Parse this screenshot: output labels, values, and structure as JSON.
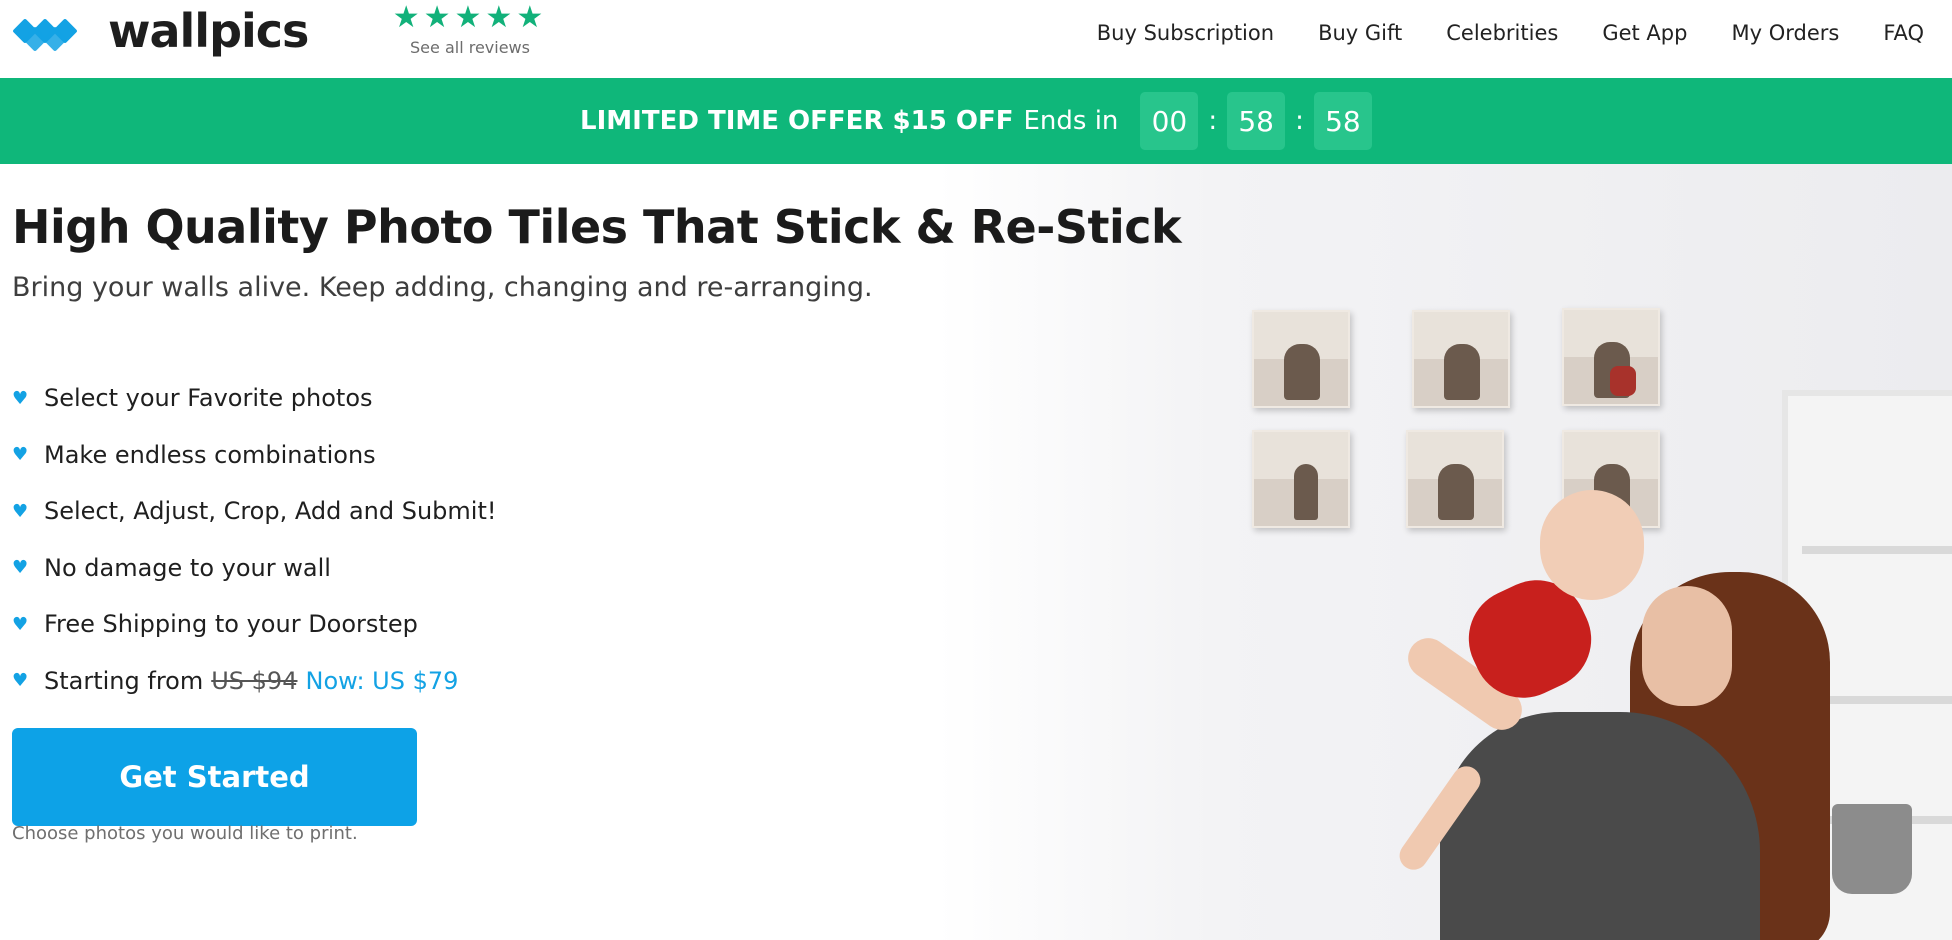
{
  "brand": {
    "name": "wallpics"
  },
  "reviews": {
    "stars": "★★★★★",
    "link_label": "See all reviews"
  },
  "nav": {
    "items": [
      {
        "label": "Buy Subscription"
      },
      {
        "label": "Buy Gift"
      },
      {
        "label": "Celebrities"
      },
      {
        "label": "Get App"
      },
      {
        "label": "My Orders"
      },
      {
        "label": "FAQ"
      }
    ]
  },
  "promo": {
    "offer": "LIMITED TIME OFFER $15 OFF",
    "ends_label": "Ends in",
    "countdown": {
      "hours": "00",
      "minutes": "58",
      "seconds": "58"
    },
    "separator": ":"
  },
  "hero": {
    "headline": "High Quality Photo Tiles That Stick & Re-Stick",
    "subhead": "Bring your walls alive. Keep adding, changing and re-arranging.",
    "features": [
      "Select your Favorite photos",
      "Make endless combinations",
      "Select, Adjust, Crop, Add and Submit!",
      "No damage to your wall",
      "Free Shipping to your Doorstep"
    ],
    "price": {
      "prefix": "Starting from",
      "old": "US $94",
      "new": "Now: US $79"
    },
    "cta_label": "Get Started",
    "cta_hint": "Choose photos you would like to print."
  },
  "icons": {
    "bullet": "heart-icon",
    "logo": "diamond-logo-icon",
    "rating": "star-icon"
  },
  "colors": {
    "accent_blue": "#0da2e7",
    "promo_green": "#0fb77a",
    "star_green": "#12b17a"
  }
}
